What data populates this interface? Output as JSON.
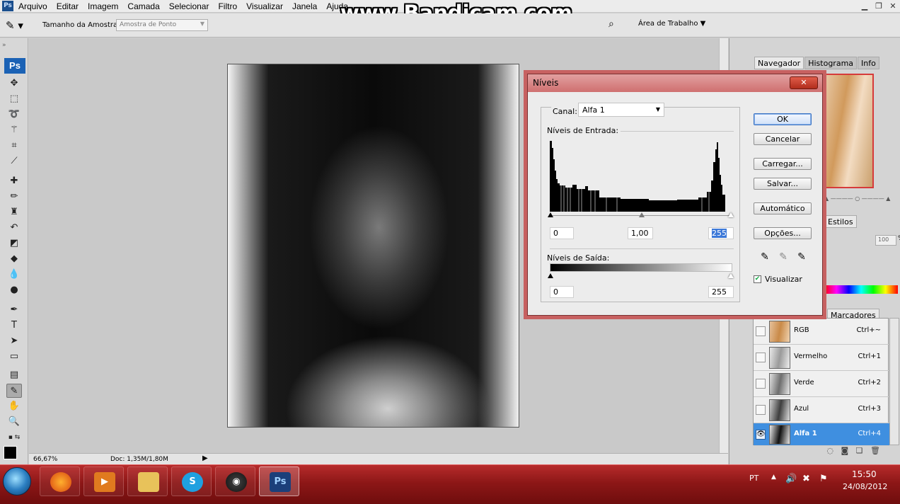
{
  "menu": {
    "items": [
      "Arquivo",
      "Editar",
      "Imagem",
      "Camada",
      "Selecionar",
      "Filtro",
      "Visualizar",
      "Janela",
      "Ajuda"
    ]
  },
  "watermark": "www.Bandicam.com",
  "options_bar": {
    "sample_size_label": "Tamanho da Amostra:",
    "sample_size_value": "Amostra de Ponto",
    "workspace_label": "Área de Trabalho"
  },
  "status": {
    "zoom": "66,67%",
    "doc": "Doc: 1,35M/1,80M"
  },
  "panels": {
    "nav_tabs": [
      "Navegador",
      "Histograma",
      "Info"
    ],
    "styles_tab": "Estilos",
    "opacity": "100",
    "opacity_unit": "%",
    "channels_tab": "Marcadores",
    "channels": [
      {
        "name": "RGB",
        "shortcut": "Ctrl+~",
        "visible": false,
        "selected": false
      },
      {
        "name": "Vermelho",
        "shortcut": "Ctrl+1",
        "visible": false,
        "selected": false
      },
      {
        "name": "Verde",
        "shortcut": "Ctrl+2",
        "visible": false,
        "selected": false
      },
      {
        "name": "Azul",
        "shortcut": "Ctrl+3",
        "visible": false,
        "selected": false
      },
      {
        "name": "Alfa 1",
        "shortcut": "Ctrl+4",
        "visible": true,
        "selected": true
      }
    ]
  },
  "dialog": {
    "title": "Níveis",
    "close_label": "✕",
    "channel_label": "Canal:",
    "channel_value": "Alfa 1",
    "input_levels_label": "Níveis de Entrada:",
    "input_black": "0",
    "input_gamma": "1,00",
    "input_white": "255",
    "output_levels_label": "Níveis de Saída:",
    "output_black": "0",
    "output_white": "255",
    "buttons": {
      "ok": "OK",
      "cancel": "Cancelar",
      "load": "Carregar...",
      "save": "Salvar...",
      "auto": "Automático",
      "options": "Opções..."
    },
    "preview_label": "Visualizar",
    "preview_checked": true
  },
  "taskbar": {
    "apps": [
      "firefox-icon",
      "media-player-icon",
      "folder-icon",
      "skype-icon",
      "bandicam-icon",
      "photoshop-icon"
    ],
    "active_app": "photoshop-icon",
    "language": "PT",
    "time": "15:50",
    "date": "24/08/2012"
  },
  "colors": {
    "taskbar": "#8d1717",
    "dialog_frame": "#c76161",
    "selection": "#3f8fe0"
  }
}
